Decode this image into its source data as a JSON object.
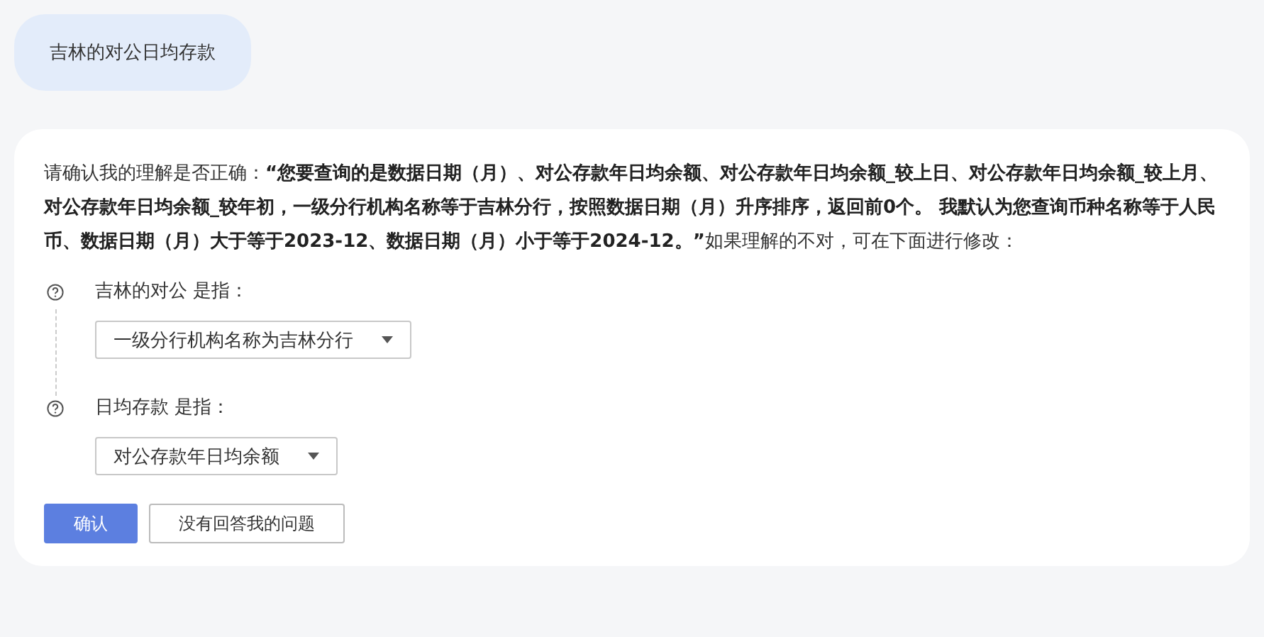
{
  "user_message": "吉林的对公日均存款",
  "reply": {
    "text": "请确认我的理解是否正确：**“您要查询的是数据日期（月）、对公存款年日均余额、对公存款年日均余额_较上日、对公存款年日均余额_较上月、对公存款年日均余额_较年初，一级分行机构名称等于吉林分行，按照数据日期（月）升序排序，返回前0个。 我默认为您查询币种名称等于人民币、数据日期（月）大于等于2023-12、数据日期（月）小于等于2024-12。”**如果理解的不对，可在下面进行修改：",
    "clarifications": [
      {
        "label": "吉林的对公 是指：",
        "value": "一级分行机构名称为吉林分行"
      },
      {
        "label": "日均存款 是指：",
        "value": "对公存款年日均余额"
      }
    ],
    "buttons": [
      {
        "label": "确认",
        "kind": "primary"
      },
      {
        "label": "没有回答我的问题",
        "kind": "secondary"
      }
    ]
  }
}
